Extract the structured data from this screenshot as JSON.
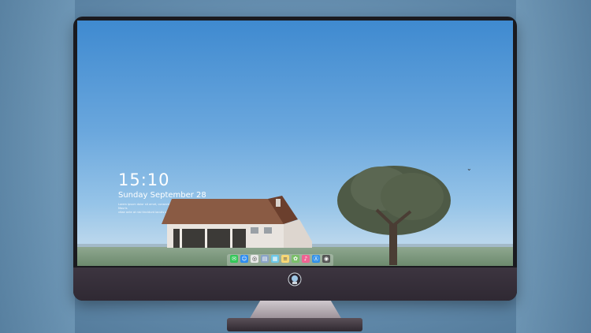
{
  "lockscreen": {
    "time": "15:10",
    "date": "Sunday September 28",
    "fine_print_1": "Lorem ipsum dolor sit amet, consectetur adipiscing elit. Mauris",
    "fine_print_2": "vitae ante at nisi tincidunt iaculis sed vitae lorem."
  },
  "dock": {
    "apps": [
      {
        "name": "messages-icon",
        "color": "#34c759"
      },
      {
        "name": "finder-icon",
        "color": "#2d8cf0"
      },
      {
        "name": "safari-icon",
        "color": "#e8e8e8"
      },
      {
        "name": "files-icon",
        "color": "#8aa4c8"
      },
      {
        "name": "clapperboard-icon",
        "color": "#6bc7e8"
      },
      {
        "name": "notes-icon",
        "color": "#f7d774"
      },
      {
        "name": "photos-icon",
        "color": "#7bbf6a"
      },
      {
        "name": "music-icon",
        "color": "#f06292"
      },
      {
        "name": "app-store-icon",
        "color": "#2f8fe8"
      },
      {
        "name": "camera-icon",
        "color": "#555555"
      }
    ]
  },
  "colors": {
    "bezel": "#1a1a1f",
    "chin": "#3d3540",
    "sky_top": "#3f8ad0"
  }
}
